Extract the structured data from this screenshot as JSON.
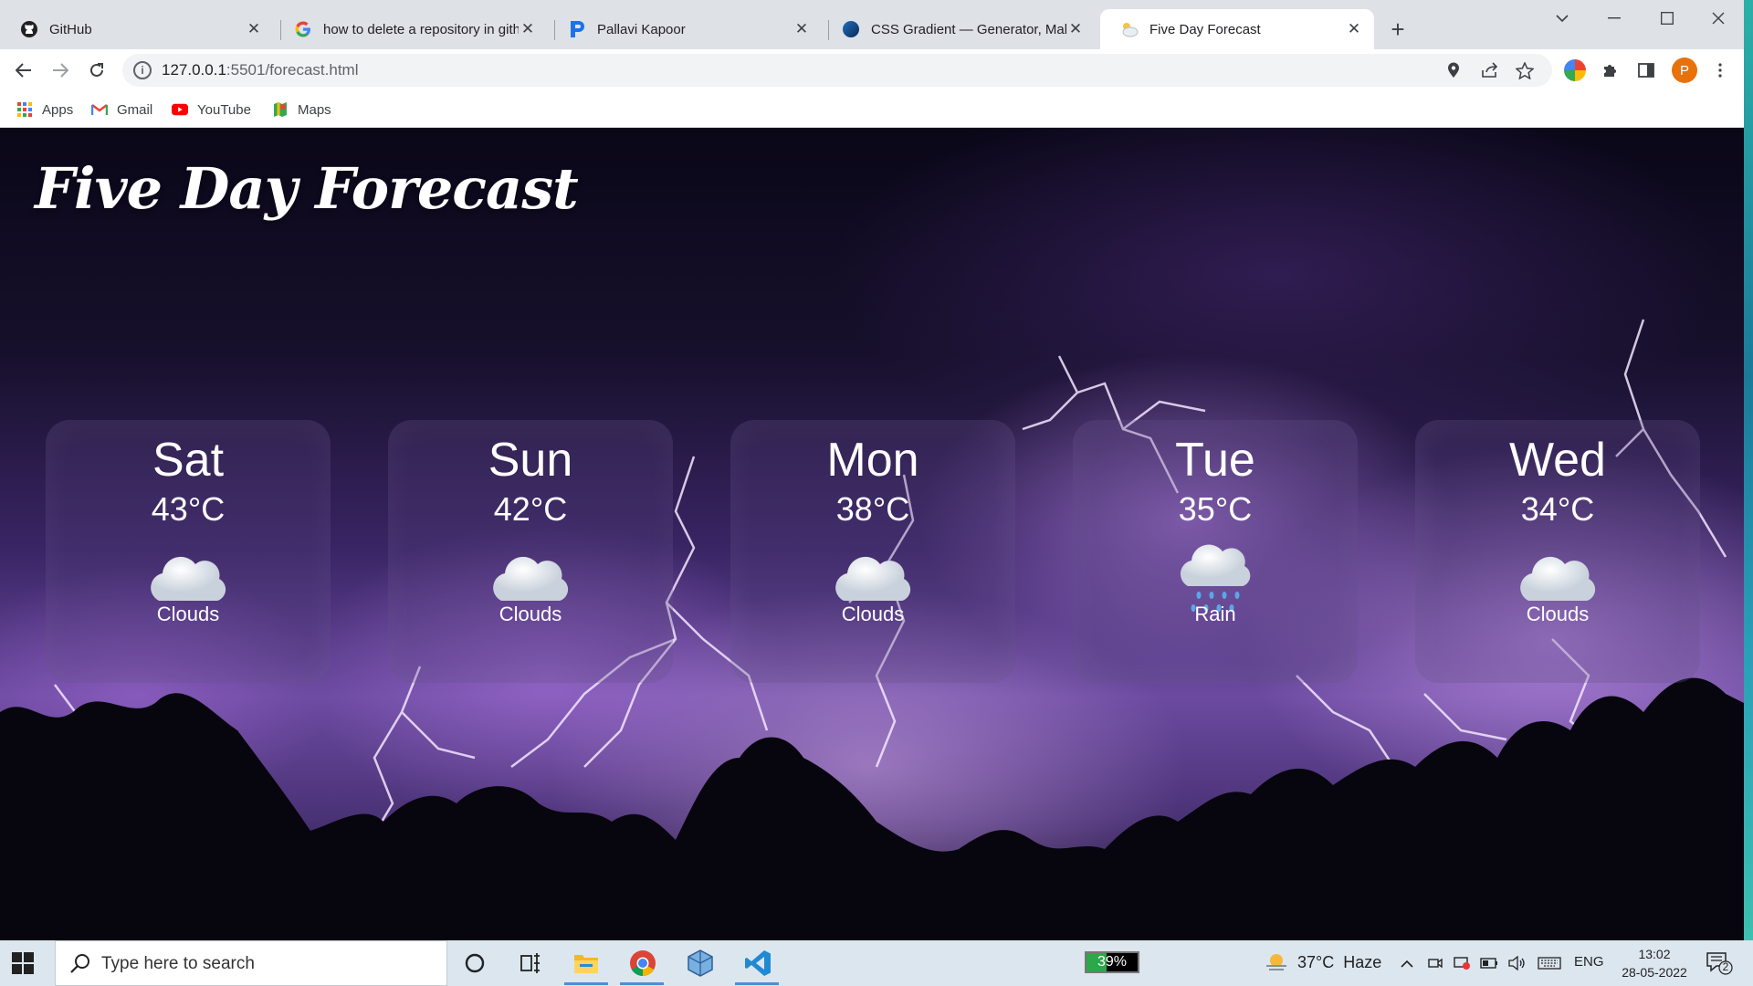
{
  "browser": {
    "tabs": [
      {
        "title": "GitHub",
        "icon": "github-icon",
        "active": false
      },
      {
        "title": "how to delete a repository in gith",
        "icon": "google-icon",
        "active": false
      },
      {
        "title": "Pallavi Kapoor",
        "icon": "p-icon",
        "active": false
      },
      {
        "title": "CSS Gradient — Generator, Make",
        "icon": "cssgradient-icon",
        "active": false
      },
      {
        "title": "Five Day Forecast",
        "icon": "weather-cloud-icon",
        "active": true
      }
    ],
    "url_host": "127.0.0.1",
    "url_rest": ":5501/forecast.html",
    "profile_initial": "P",
    "bookmarks": [
      {
        "label": "Apps",
        "icon": "apps-grid-icon"
      },
      {
        "label": "Gmail",
        "icon": "gmail-icon"
      },
      {
        "label": "YouTube",
        "icon": "youtube-icon"
      },
      {
        "label": "Maps",
        "icon": "maps-icon"
      }
    ]
  },
  "page": {
    "title": "Five Day Forecast",
    "forecast": [
      {
        "day": "Sat",
        "temp": "43°C",
        "condition": "Clouds",
        "icon": "cloud-icon"
      },
      {
        "day": "Sun",
        "temp": "42°C",
        "condition": "Clouds",
        "icon": "cloud-icon"
      },
      {
        "day": "Mon",
        "temp": "38°C",
        "condition": "Clouds",
        "icon": "cloud-icon"
      },
      {
        "day": "Tue",
        "temp": "35°C",
        "condition": "Rain",
        "icon": "rain-cloud-icon"
      },
      {
        "day": "Wed",
        "temp": "34°C",
        "condition": "Clouds",
        "icon": "cloud-icon"
      }
    ]
  },
  "taskbar": {
    "search_placeholder": "Type here to search",
    "battery_percent": "39%",
    "battery_level": 0.39,
    "weather_temp": "37°C",
    "weather_text": "Haze",
    "language": "ENG",
    "time": "13:02",
    "date": "28-05-2022",
    "notification_count": "2"
  },
  "colors": {
    "tabstrip": "#dee1e6",
    "profile": "#e8710a",
    "taskbar": "#dce6ef",
    "accent": "#4c8fd8"
  }
}
